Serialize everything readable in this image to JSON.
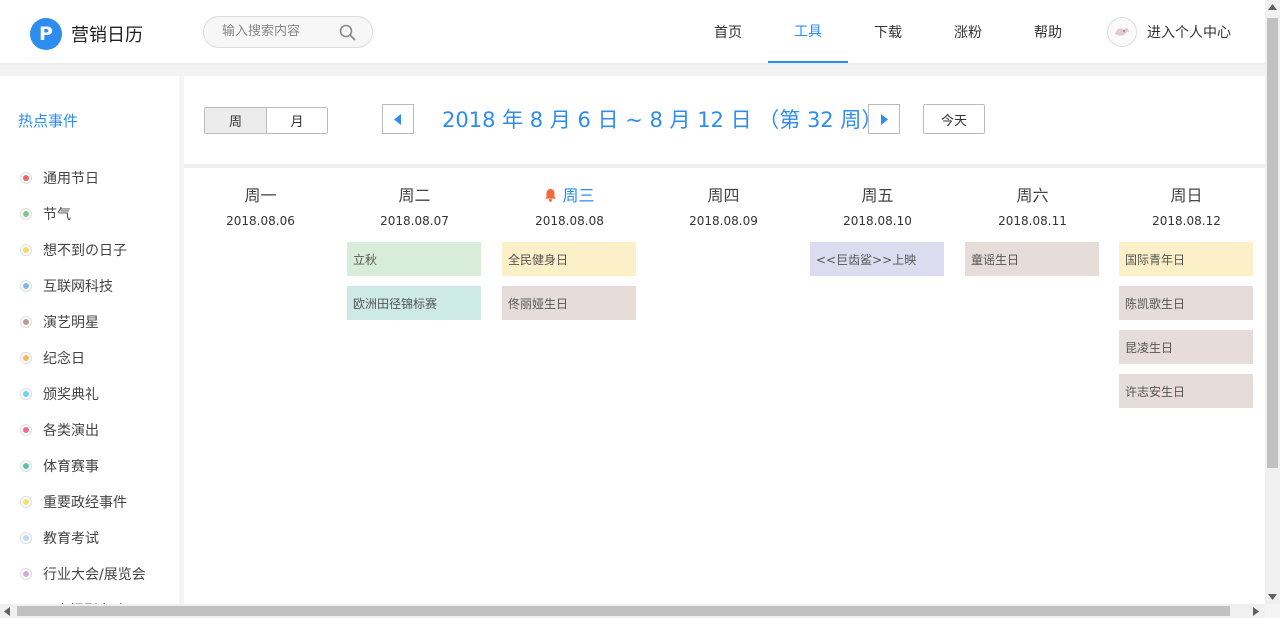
{
  "header": {
    "logo_letter": "P",
    "app_name": "营销日历",
    "search_placeholder": "输入搜索内容",
    "nav": [
      {
        "label": "首页",
        "active": false
      },
      {
        "label": "工具",
        "active": true
      },
      {
        "label": "下载",
        "active": false
      },
      {
        "label": "涨粉",
        "active": false
      },
      {
        "label": "帮助",
        "active": false
      }
    ],
    "user_label": "进入个人中心"
  },
  "sidebar": {
    "title": "热点事件",
    "categories": [
      {
        "label": "通用节日",
        "color": "#e8636a"
      },
      {
        "label": "节气",
        "color": "#7cc98a"
      },
      {
        "label": "想不到の日子",
        "color": "#f5d96b"
      },
      {
        "label": "互联网科技",
        "color": "#7bb8ec"
      },
      {
        "label": "演艺明星",
        "color": "#b89c92"
      },
      {
        "label": "纪念日",
        "color": "#f5b85c"
      },
      {
        "label": "颁奖典礼",
        "color": "#6fd4e3"
      },
      {
        "label": "各类演出",
        "color": "#ef6c8f"
      },
      {
        "label": "体育赛事",
        "color": "#5cbfb0"
      },
      {
        "label": "重要政经事件",
        "color": "#f5e06b"
      },
      {
        "label": "教育考试",
        "color": "#b8dcf5"
      },
      {
        "label": "行业大会/展览会",
        "color": "#d7a8e3"
      },
      {
        "label": "IP电视剧上映",
        "color": "#d6a9e6"
      }
    ]
  },
  "toolbar": {
    "week_label": "周",
    "month_label": "月",
    "active_view": "周",
    "range_title": "2018 年 8 月 6 日 ~ 8 月 12 日 （第 32 周）",
    "today_label": "今天"
  },
  "days": [
    {
      "name": "周一",
      "date": "2018.08.06",
      "today": false,
      "events": []
    },
    {
      "name": "周二",
      "date": "2018.08.07",
      "today": false,
      "events": [
        {
          "title": "立秋",
          "color": "#d7ecd9"
        },
        {
          "title": "欧洲田径锦标赛",
          "color": "#cdeae6"
        }
      ]
    },
    {
      "name": "周三",
      "date": "2018.08.08",
      "today": true,
      "events": [
        {
          "title": "全民健身日",
          "color": "#fcf0c8"
        },
        {
          "title": "佟丽娅生日",
          "color": "#e6dcda"
        }
      ]
    },
    {
      "name": "周四",
      "date": "2018.08.09",
      "today": false,
      "events": []
    },
    {
      "name": "周五",
      "date": "2018.08.10",
      "today": false,
      "events": [
        {
          "title": "<<巨齿鲨>>上映",
          "color": "#dcdcf0"
        }
      ]
    },
    {
      "name": "周六",
      "date": "2018.08.11",
      "today": false,
      "events": [
        {
          "title": "童谣生日",
          "color": "#e6dcda"
        }
      ]
    },
    {
      "name": "周日",
      "date": "2018.08.12",
      "today": false,
      "events": [
        {
          "title": "国际青年日",
          "color": "#fcf0c8"
        },
        {
          "title": "陈凯歌生日",
          "color": "#e6dcda"
        },
        {
          "title": "昆凌生日",
          "color": "#e6dcda"
        },
        {
          "title": "许志安生日",
          "color": "#e6dcda"
        }
      ]
    }
  ],
  "icons": {
    "search": "search-icon",
    "prev": "chevron-left-icon",
    "next": "chevron-right-icon",
    "bell": "bell-icon",
    "avatar": "avatar-icon"
  },
  "colors": {
    "accent": "#2d8cf0",
    "bell": "#f26b3a"
  }
}
